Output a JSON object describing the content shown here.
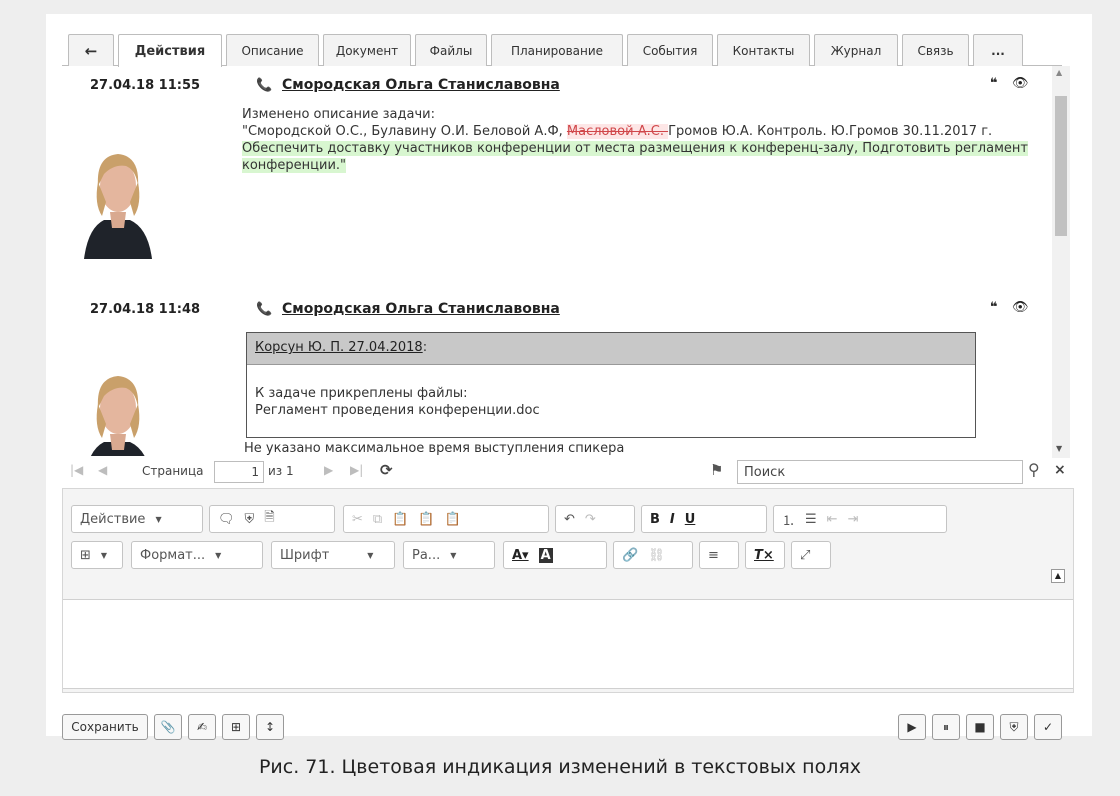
{
  "tabs": [
    {
      "label": "←",
      "icon": "back-arrow-icon"
    },
    {
      "label": "Действия",
      "active": true
    },
    {
      "label": "Описание"
    },
    {
      "label": "Документ"
    },
    {
      "label": "Файлы"
    },
    {
      "label": "Планирование"
    },
    {
      "label": "События"
    },
    {
      "label": "Контакты"
    },
    {
      "label": "Журнал"
    },
    {
      "label": "Связь"
    },
    {
      "label": "..."
    }
  ],
  "entries": [
    {
      "time": "27.04.18 11:55",
      "author": "Смородская Ольга Станиславовна",
      "text_intro": "Изменено описание задачи:",
      "text_normal": "\"Смородской О.С., Булавину О.И. Беловой А.Ф, ",
      "text_deleted": "Масловой А.С. ",
      "text_after_deleted": "Громов Ю.А. Контроль. Ю.Громов 30.11.2017 г. ",
      "text_inserted": " Обеспечить доставку участников конференции от места размещения к конференц-залу, Подготовить регламент конференции.",
      "text_end": "\""
    },
    {
      "time": "27.04.18 11:48",
      "author": "Смородская Ольга Станиславовна",
      "comment_author": "Корсун Ю. П. 27.04.2018",
      "comment_colon": ":",
      "comment_line1": "К задаче прикреплены файлы:",
      "comment_line2": "Регламент проведения конференции.doc",
      "text_after": "Не указано максимальное время выступления спикера"
    }
  ],
  "pager": {
    "page_label": "Страница",
    "page_value": "1",
    "of_label": "из 1",
    "search_placeholder": "Поиск"
  },
  "editor": {
    "action_label": "Действие",
    "format_label": "Формат...",
    "font_label": "Шрифт",
    "size_label": "Ра...",
    "bold": "B",
    "italic": "I",
    "underline": "U"
  },
  "bottom": {
    "save_label": "Сохранить"
  },
  "caption": "Рис. 71. Цветовая индикация изменений в текстовых полях"
}
